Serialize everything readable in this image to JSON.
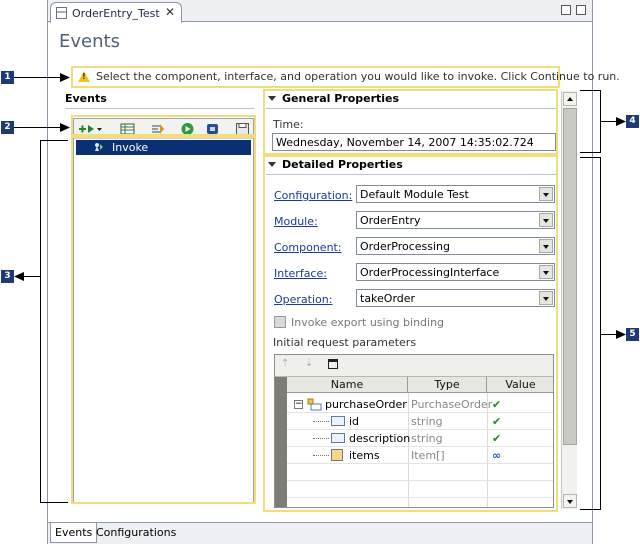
{
  "editor_tab": {
    "label": "OrderEntry_Test",
    "close_glyph": "✕"
  },
  "page_title": "Events",
  "info_message": "Select the component, interface, and operation you would like to invoke. Click Continue to run.",
  "events_panel": {
    "title": "Events",
    "tree_items": [
      {
        "label": "Invoke"
      }
    ]
  },
  "general_properties": {
    "title": "General Properties",
    "time_label": "Time:",
    "time_value": "Wednesday, November 14, 2007 14:35:02.724"
  },
  "detailed_properties": {
    "title": "Detailed Properties",
    "fields": [
      {
        "label": "Configuration:",
        "value": "Default Module Test"
      },
      {
        "label": "Module:",
        "value": "OrderEntry"
      },
      {
        "label": "Component:",
        "value": "OrderProcessing"
      },
      {
        "label": "Interface:",
        "value": "OrderProcessingInterface"
      },
      {
        "label": "Operation:",
        "value": "takeOrder"
      }
    ],
    "invoke_binding_label": "Invoke export using binding",
    "params_label": "Initial request parameters",
    "columns": [
      "Name",
      "Type",
      "Value"
    ],
    "rows": [
      {
        "name": "purchaseOrder",
        "type": "PurchaseOrder",
        "value": "✔"
      },
      {
        "name": "id",
        "type": "string",
        "value": "✔"
      },
      {
        "name": "description",
        "type": "string",
        "value": "✔"
      },
      {
        "name": "items",
        "type": "Item[]",
        "value": "∞"
      }
    ]
  },
  "bottom_tabs": [
    "Events",
    "Configurations"
  ],
  "callouts": [
    "1",
    "2",
    "3",
    "4",
    "5"
  ],
  "colors": {
    "highlight": "#f3dc7e",
    "callout": "#1f3a73",
    "selection": "#0b2f73"
  }
}
